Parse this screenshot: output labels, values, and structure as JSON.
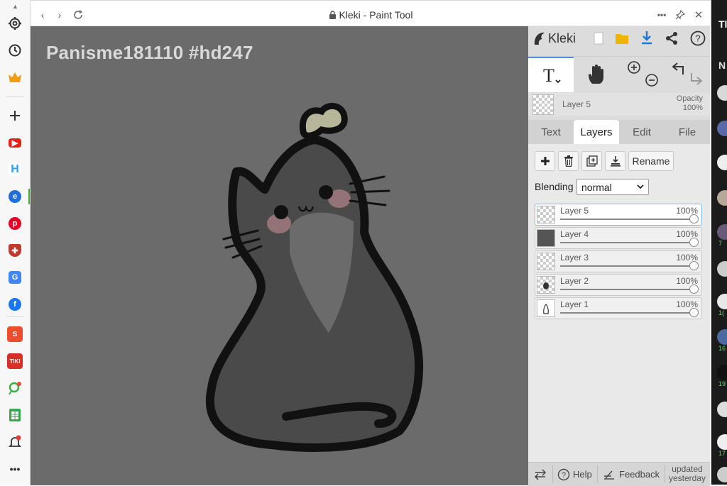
{
  "window": {
    "title": "Kleki - Paint Tool"
  },
  "canvas": {
    "text": "Panisme181110 #hd247"
  },
  "panel": {
    "brand": "Kleki",
    "current_layer": {
      "name": "Layer 5",
      "opacity_label": "Opacity",
      "opacity_value": "100%"
    },
    "tabs": [
      {
        "label": "Text"
      },
      {
        "label": "Layers"
      },
      {
        "label": "Edit"
      },
      {
        "label": "File"
      }
    ],
    "layer_buttons": {
      "rename": "Rename"
    },
    "blending": {
      "label": "Blending",
      "value": "normal"
    },
    "layers": [
      {
        "name": "Layer 5",
        "opacity": "100%"
      },
      {
        "name": "Layer 4",
        "opacity": "100%"
      },
      {
        "name": "Layer 3",
        "opacity": "100%"
      },
      {
        "name": "Layer 2",
        "opacity": "100%"
      },
      {
        "name": "Layer 1",
        "opacity": "100%"
      }
    ],
    "bottom": {
      "help": "Help",
      "feedback": "Feedback",
      "updated": "updated yesterday"
    }
  },
  "right_strip": {
    "letter_t": "Tl",
    "letter_n": "N",
    "counts": [
      "7",
      "1(",
      "16",
      "19",
      "17"
    ]
  },
  "colors": {
    "accent": "#4c8ee8",
    "canvas_bg": "#6b6b6b",
    "download": "#1a7ad8",
    "folder": "#f0b400"
  }
}
